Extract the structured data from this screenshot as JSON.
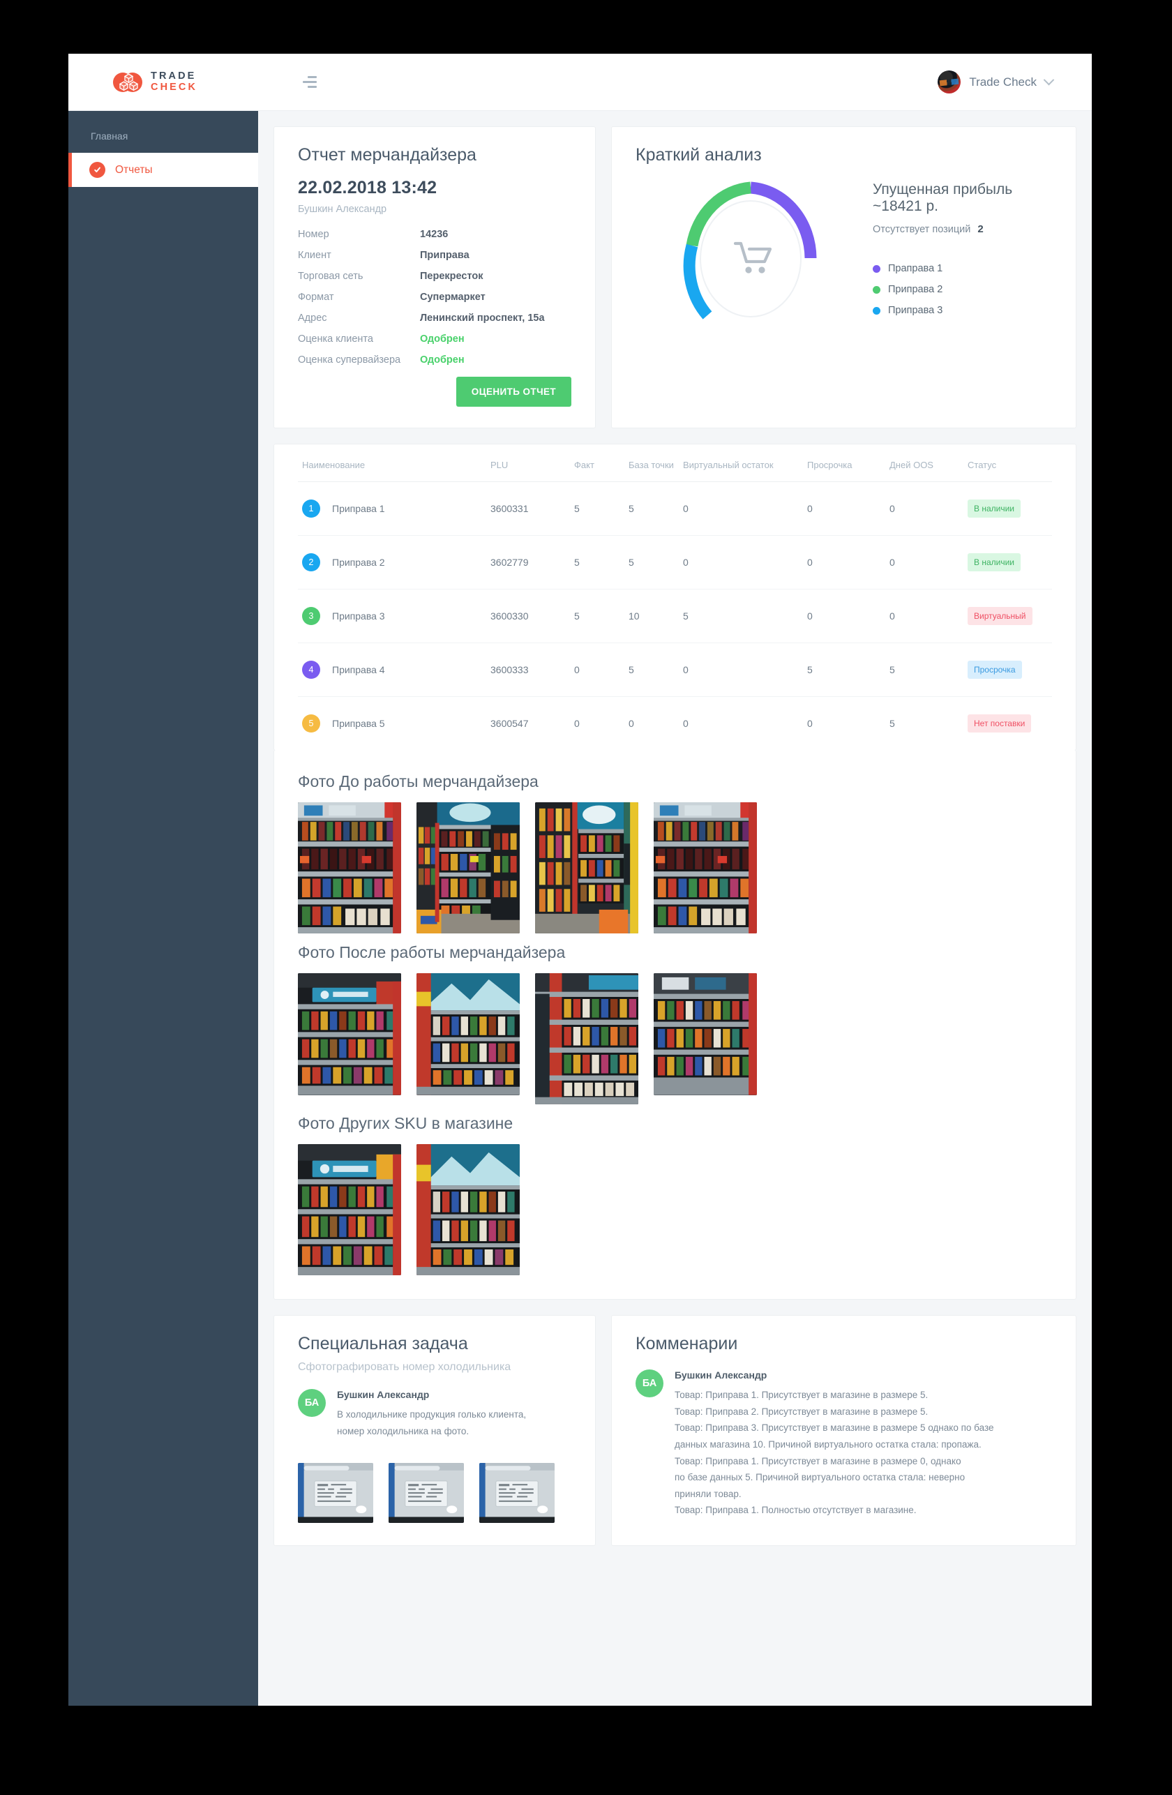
{
  "brand": {
    "line1": "TRADE",
    "line2": "CHECK",
    "logo_icon": "cubes-icon"
  },
  "topbar": {
    "menu_icon": "hamburger-icon",
    "user_name": "Trade Check",
    "avatar_icon": "user-avatar",
    "chevron_icon": "chevron-down-icon"
  },
  "sidebar": {
    "caption": "Главная",
    "items": [
      {
        "label": "Отчеты",
        "icon": "reports-icon",
        "active": true
      }
    ]
  },
  "report": {
    "title": "Отчет мерчандайзера",
    "datetime": "22.02.2018  13:42",
    "author": "Бушкин Александр",
    "fields": [
      {
        "key": "Номер",
        "value": "14236",
        "state": "normal"
      },
      {
        "key": "Клиент",
        "value": "Приправа",
        "state": "normal"
      },
      {
        "key": "Торговая сеть",
        "value": "Перекресток",
        "state": "normal"
      },
      {
        "key": "Формат",
        "value": "Супермаркет",
        "state": "normal"
      },
      {
        "key": "Адрес",
        "value": "Ленинский проспект, 15а",
        "state": "normal"
      },
      {
        "key": "Оценка клиента",
        "value": "Одобрен",
        "state": "ok"
      },
      {
        "key": "Оценка супервайзера",
        "value": "Одобрен",
        "state": "ok"
      }
    ],
    "button_label": "ОЦЕНИТЬ ОТЧЕТ"
  },
  "analysis": {
    "title": "Краткий анализ",
    "profit_text": "Упущенная прибыль ~18421 р.",
    "missing_label": "Отсутствует позиций",
    "missing_count": "2",
    "center_icon": "shopping-cart-icon",
    "legend": [
      {
        "label": "Праправа 1",
        "color": "#7a5cf0"
      },
      {
        "label": "Приправа 2",
        "color": "#4ecb71"
      },
      {
        "label": "Приправа 3",
        "color": "#19a7f0"
      }
    ]
  },
  "chart_data": {
    "type": "pie",
    "title": "Краткий анализ",
    "labels": [
      "Праправа 1",
      "Приправа 2",
      "Приправа 3"
    ],
    "values": [
      33,
      25,
      25
    ],
    "colors": [
      "#7a5cf0",
      "#4ecb71",
      "#19a7f0"
    ],
    "unit": "%",
    "donut": true,
    "total_gap_percent": 17,
    "legend_position": "right",
    "annotations": [
      "Упущенная прибыль ~18421 р.",
      "Отсутствует позиций 2"
    ]
  },
  "table": {
    "columns": [
      "Наименование",
      "PLU",
      "Факт",
      "База точки",
      "Виртуальный остаток",
      "Просрочка",
      "Дней OOS",
      "Статус"
    ],
    "rows": [
      {
        "idx": "1",
        "color": "#19a7f0",
        "name": "Приправа 1",
        "plu": "3600331",
        "fact": "5",
        "base": "5",
        "virtual": "0",
        "expired": "0",
        "oos": "0",
        "status": "В наличии",
        "status_style": "green"
      },
      {
        "idx": "2",
        "color": "#19a7f0",
        "name": "Приправа 2",
        "plu": "3602779",
        "fact": "5",
        "base": "5",
        "virtual": "0",
        "expired": "0",
        "oos": "0",
        "status": "В наличии",
        "status_style": "green"
      },
      {
        "idx": "3",
        "color": "#4ecb71",
        "name": "Приправа 3",
        "plu": "3600330",
        "fact": "5",
        "base": "10",
        "virtual": "5",
        "expired": "0",
        "oos": "0",
        "status": "Виртуальный",
        "status_style": "red"
      },
      {
        "idx": "4",
        "color": "#7a5cf0",
        "name": "Приправа 4",
        "plu": "3600333",
        "fact": "0",
        "base": "5",
        "virtual": "0",
        "expired": "5",
        "oos": "5",
        "status": "Просрочка",
        "status_style": "blue"
      },
      {
        "idx": "5",
        "color": "#f6bb42",
        "name": "Приправа 5",
        "plu": "3600547",
        "fact": "0",
        "base": "0",
        "virtual": "0",
        "expired": "0",
        "oos": "5",
        "status": "Нет поставки",
        "status_style": "red"
      }
    ]
  },
  "photos": {
    "before_title": "Фото До работы мерчандайзера",
    "before_count": 4,
    "after_title": "Фото После работы мерчандайзера",
    "after_count": 4,
    "other_title": "Фото Других SKU в магазине",
    "other_count": 2
  },
  "task": {
    "title": "Специальная задача",
    "subtitle": "Сфотографировать номер холодильника",
    "author_initials": "БА",
    "author_name": "Бушкин Александр",
    "text_lines": [
      "В холодильнике продукция голько клиента,",
      "номер холодильника на фото."
    ],
    "photo_count": 3
  },
  "comments": {
    "title": "Комменарии",
    "author_initials": "БА",
    "author_name": "Бушкин Александр",
    "lines": [
      "Товар: Приправа 1. Присутствует в магазине в размере 5.",
      "Товар: Приправа 2. Присутствует в магазине в размере 5.",
      "Товар: Приправа 3. Присутствует в магазине в размере 5 однако по базе",
      "данных магазина 10. Причиной виртуального остатка стала: пропажа.",
      "Товар: Приправа 1. Присутствует в магазине в размере 0, однако",
      "по базе данных 5. Причиной виртуального остатка стала: неверно",
      "приняли товар.",
      "Товар: Приправа 1. Полностью отсутствует в магазине."
    ]
  },
  "colors": {
    "brand_orange": "#f0573f",
    "sidebar_bg": "#37495a",
    "accent_green": "#4ecb71",
    "page_bg": "#f4f6f8"
  }
}
